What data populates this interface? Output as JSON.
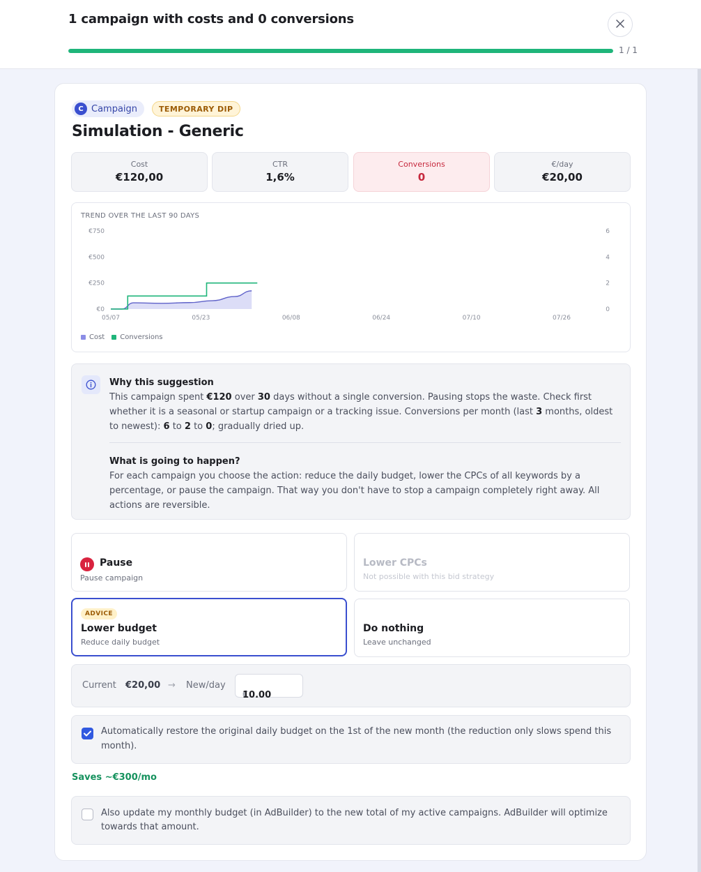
{
  "header": {
    "title": "1 campaign with costs and 0 conversions",
    "progress": 1.0,
    "progress_text": "1 / 1"
  },
  "campaign": {
    "type_label": "Campaign",
    "type_initial": "C",
    "status_badge": "TEMPORARY DIP",
    "name": "Simulation - Generic"
  },
  "stats": [
    {
      "label": "Cost",
      "value": "€120,00",
      "alert": false
    },
    {
      "label": "CTR",
      "value": "1,6%",
      "alert": false
    },
    {
      "label": "Conversions",
      "value": "0",
      "alert": true
    },
    {
      "label": "€/day",
      "value": "€20,00",
      "alert": false
    }
  ],
  "chart_heading": "TREND OVER THE LAST 90 DAYS",
  "chart_data": {
    "type": "line",
    "title": "TREND OVER THE LAST 90 DAYS",
    "x_ticks": [
      "05/07",
      "05/23",
      "06/08",
      "06/24",
      "07/10",
      "07/26"
    ],
    "y_left_ticks": [
      "€0",
      "€250",
      "€500",
      "€750"
    ],
    "y_right_ticks": [
      "0",
      "2",
      "4",
      "6"
    ],
    "y_left_range": [
      0,
      750
    ],
    "y_right_range": [
      0,
      6
    ],
    "legend_position": "bottom-left",
    "series": [
      {
        "name": "Cost",
        "axis": "left",
        "color": "#8b8de6",
        "style": "area",
        "points": [
          {
            "x": "05/07",
            "y": 0
          },
          {
            "x": "05/09",
            "y": 0
          },
          {
            "x": "05/11",
            "y": 60
          },
          {
            "x": "05/16",
            "y": 55
          },
          {
            "x": "05/21",
            "y": 62
          },
          {
            "x": "05/25",
            "y": 80
          },
          {
            "x": "05/29",
            "y": 120
          },
          {
            "x": "06/01",
            "y": 175
          }
        ]
      },
      {
        "name": "Conversions",
        "axis": "right",
        "color": "#1fb57a",
        "style": "step",
        "points": [
          {
            "x": "05/07",
            "y": 0
          },
          {
            "x": "05/10",
            "y": 0
          },
          {
            "x": "05/10",
            "y": 1
          },
          {
            "x": "05/24",
            "y": 1
          },
          {
            "x": "05/24",
            "y": 2
          },
          {
            "x": "06/02",
            "y": 2
          }
        ]
      }
    ]
  },
  "info": {
    "why_heading": "Why this suggestion",
    "why_p1": "This campaign spent ",
    "why_b1": "€120",
    "why_p2": " over ",
    "why_b2": "30",
    "why_p3": " days without a single conversion. Pausing stops the waste. Check first whether it is a seasonal or startup campaign or a tracking issue. Conversions per month (last ",
    "why_b3": "3",
    "why_p4": " months, oldest to newest): ",
    "why_b4": "6",
    "why_p5": " to ",
    "why_b5": "2",
    "why_p6": " to ",
    "why_b6": "0",
    "why_p7": "; gradually dried up.",
    "what_heading": "What is going to happen?",
    "what_text": "For each campaign you choose the action: reduce the daily budget, lower the CPCs of all keywords by a percentage, or pause the campaign. That way you don't have to stop a campaign completely right away. All actions are reversible."
  },
  "options": {
    "pause": {
      "title": "Pause",
      "sub": "Pause campaign"
    },
    "lower_cpcs": {
      "title": "Lower CPCs",
      "sub": "Not possible with this bid strategy"
    },
    "lower_budget": {
      "badge": "ADVICE",
      "title": "Lower budget",
      "sub": "Reduce daily budget"
    },
    "do_nothing": {
      "title": "Do nothing",
      "sub": "Leave unchanged"
    }
  },
  "budget": {
    "current_label": "Current",
    "current_value": "€20,00",
    "arrow": "→",
    "new_label": "New/day",
    "currency_symbol": "€",
    "new_value": "10.00"
  },
  "restore_checkbox": {
    "checked": true,
    "text": "Automatically restore the original daily budget on the 1st of the new month (the reduction only slows spend this month)."
  },
  "saves_text": "Saves ~€300/mo",
  "monthly_checkbox": {
    "checked": false,
    "text": "Also update my monthly budget (in AdBuilder) to the new total of my active campaigns. AdBuilder will optimize towards that amount."
  },
  "colors": {
    "accent": "#3a4fcf",
    "success": "#1fb57a",
    "danger": "#d9233f",
    "cost_series": "#8b8de6"
  }
}
